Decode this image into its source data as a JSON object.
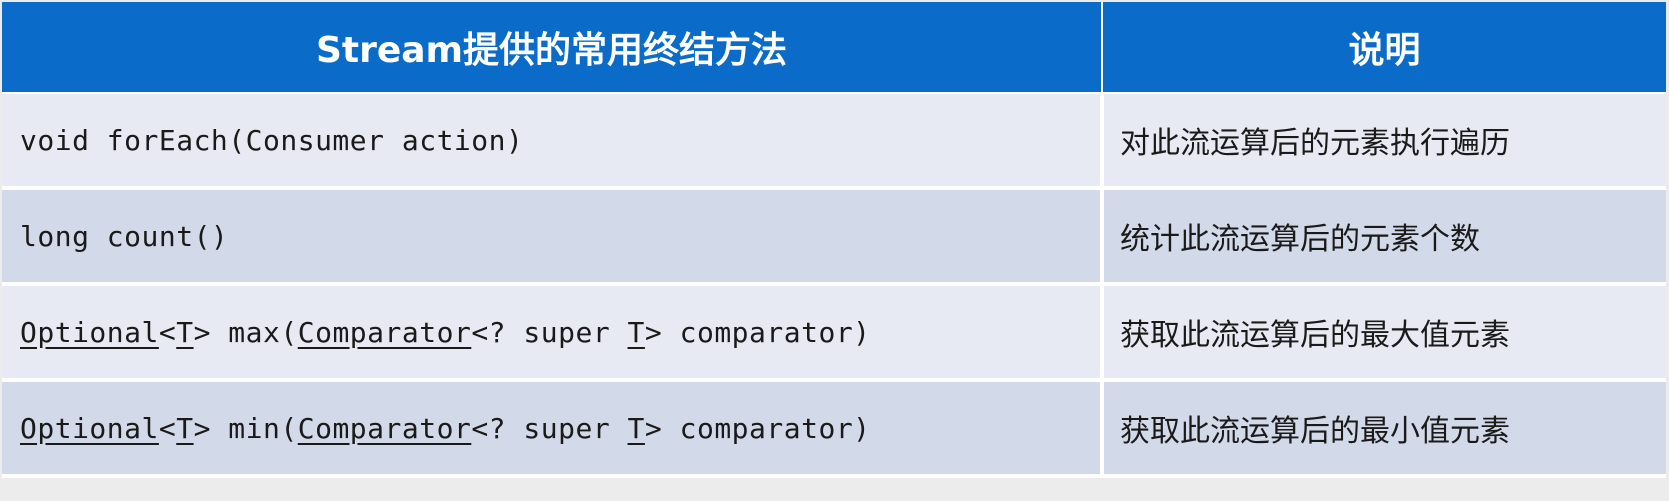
{
  "header": {
    "method_col": "Stream提供的常用终结方法",
    "desc_col": "说明"
  },
  "rows": [
    {
      "method": {
        "prefix": "void forEach(Consumer action)"
      },
      "desc": "对此流运算后的元素执行遍历"
    },
    {
      "method": {
        "prefix": "long count()"
      },
      "desc": "统计此流运算后的元素个数"
    },
    {
      "method": {
        "t1": "Optional",
        "t2": "<",
        "t3": "T",
        "t4": "> max(",
        "t5": "Comparator",
        "t6": "<? super ",
        "t7": "T",
        "t8": "> comparator)"
      },
      "desc": "获取此流运算后的最大值元素"
    },
    {
      "method": {
        "t1": "Optional",
        "t2": "<",
        "t3": "T",
        "t4": "> min(",
        "t5": "Comparator",
        "t6": "<? super ",
        "t7": "T",
        "t8": "> comparator)"
      },
      "desc": "获取此流运算后的最小值元素"
    }
  ]
}
